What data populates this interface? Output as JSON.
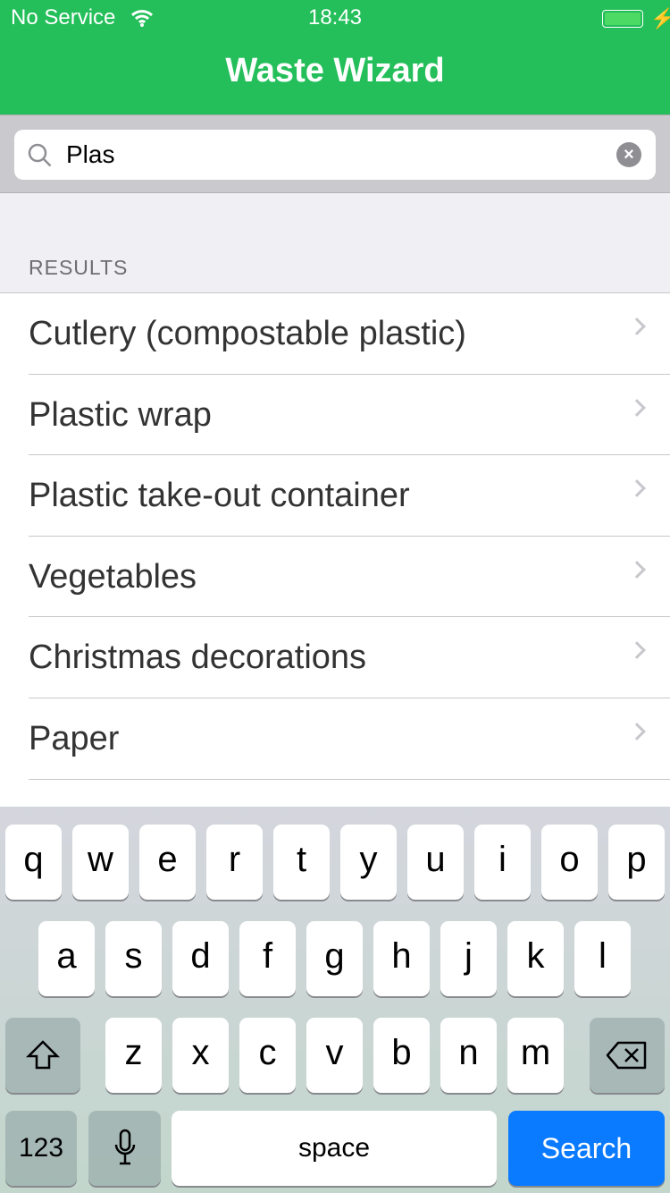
{
  "status": {
    "carrier": "No Service",
    "time": "18:43",
    "battery_level": 1.0,
    "charging": true
  },
  "nav": {
    "title": "Waste Wizard",
    "color": "#24bf5a"
  },
  "search": {
    "value": "Plas",
    "placeholder": ""
  },
  "results": {
    "header": "RESULTS",
    "items": [
      {
        "label": "Cutlery (compostable plastic)"
      },
      {
        "label": "Plastic wrap"
      },
      {
        "label": "Plastic take-out container"
      },
      {
        "label": "Vegetables"
      },
      {
        "label": "Christmas decorations"
      },
      {
        "label": "Paper"
      }
    ]
  },
  "keyboard": {
    "row1": [
      "q",
      "w",
      "e",
      "r",
      "t",
      "y",
      "u",
      "i",
      "o",
      "p"
    ],
    "row2": [
      "a",
      "s",
      "d",
      "f",
      "g",
      "h",
      "j",
      "k",
      "l"
    ],
    "row3": [
      "z",
      "x",
      "c",
      "v",
      "b",
      "n",
      "m"
    ],
    "numbers": "123",
    "space": "space",
    "search": "Search",
    "search_color": "#0a7aff"
  }
}
